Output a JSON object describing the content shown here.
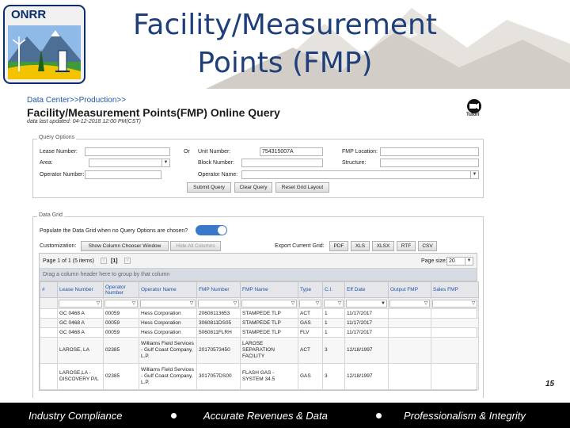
{
  "slide": {
    "logo_text": "ONRR",
    "title_line1": "Facility/Measurement",
    "title_line2": "Points (FMP)",
    "page_number": "15"
  },
  "footer": {
    "item1": "Industry Compliance",
    "item2": "Accurate Revenues & Data",
    "item3": "Professionalism & Integrity"
  },
  "app": {
    "breadcrumb": "Data Center>>Production>>",
    "page_title": "Facility/Measurement Points(FMP) Online Query",
    "data_updated": "data last updated: 04-12-2018 12:00 PM(CST)",
    "tutorial_label": "Tutori"
  },
  "query_options": {
    "legend": "Query Options",
    "lease_number_label": "Lease Number:",
    "or_label": "Or",
    "unit_number_label": "Unit Number:",
    "unit_number_value": "754315007A",
    "fmp_location_label": "FMP Location:",
    "area_label": "Area:",
    "block_number_label": "Block Number:",
    "structure_label": "Structure:",
    "operator_number_label": "Operator Number:",
    "operator_name_label": "Operator Name:",
    "submit_label": "Submit Query",
    "clear_label": "Clear Query",
    "reset_label": "Reset Grid Layout"
  },
  "data_grid": {
    "legend": "Data Grid",
    "populate_label": "Populate the Data Grid when no Query Options are chosen?",
    "customization_label": "Customization:",
    "show_chooser_label": "Show Column Chooser Window",
    "hide_all_label": "Hide All Columns",
    "export_label": "Export Current Grid:",
    "export_formats": [
      "PDF",
      "XLS",
      "XLSX",
      "RTF",
      "CSV"
    ],
    "pager_info": "Page 1 of 1 (5 items)",
    "current_page": "[1]",
    "page_size_label": "Page size:",
    "page_size_value": "20",
    "group_hint": "Drag a column header here to group by that column",
    "columns": [
      "#",
      "Lease Number",
      "Operator Number",
      "Operator Name",
      "FMP Number",
      "FMP Name",
      "Type",
      "C.I.",
      "Eff Date",
      "Output FMP",
      "Sales FMP"
    ],
    "rows": [
      [
        "",
        "GC 0468 A",
        "00059",
        "Hess Corporation",
        "20608113653",
        "STAMPEDE TLP",
        "ACT",
        "1",
        "11/17/2017",
        "",
        ""
      ],
      [
        "",
        "GC 0468 A",
        "00059",
        "Hess Corporation",
        "3060811DS05",
        "STAMPEDE TLP",
        "GAS",
        "1",
        "11/17/2017",
        "",
        ""
      ],
      [
        "",
        "GC 0468 A",
        "00059",
        "Hess Corporation",
        "5060811FLRH",
        "STAMPEDE TLP",
        "FLV",
        "1",
        "11/17/2017",
        "",
        ""
      ],
      [
        "",
        "LAROSE, LA",
        "02385",
        "Williams Field Services - Gulf Coast Company, L.P.",
        "20170573450",
        "LAROSE SEPARATION FACILITY",
        "ACT",
        "3",
        "12/18/1997",
        "",
        ""
      ],
      [
        "",
        "LAROSE,LA - DISCOVERY P/L",
        "02385",
        "Williams Field Services - Gulf Coast Company, L.P.",
        "3017057DS00",
        "FLASH GAS - SYSTEM 34.5",
        "GAS",
        "3",
        "12/18/1997",
        "",
        ""
      ]
    ]
  },
  "colors": {
    "title": "#1e3f7a",
    "link": "#1f57a8",
    "footer_bg": "#000000",
    "toggle_on": "#3a78c9"
  }
}
